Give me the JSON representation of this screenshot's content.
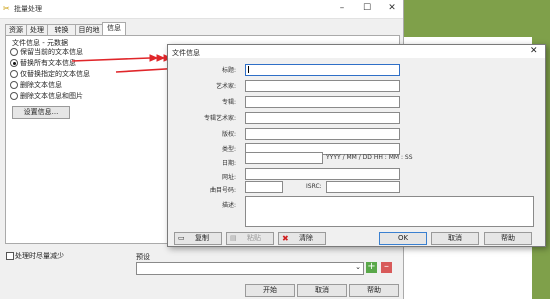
{
  "main_window": {
    "title": "批量处理",
    "tabs": [
      {
        "label": "资源",
        "active": false
      },
      {
        "label": "处理",
        "active": false
      },
      {
        "label": "转换",
        "active": false
      },
      {
        "label": "目的地",
        "active": false
      },
      {
        "label": "信息",
        "active": true
      }
    ],
    "group_title": "文件信息 - 元数据",
    "radio_options": [
      {
        "label": "保留当前的文本信息",
        "selected": false
      },
      {
        "label": "替换所有文本信息",
        "selected": true
      },
      {
        "label": "仅替换指定的文本信息",
        "selected": false
      },
      {
        "label": "删除文本信息",
        "selected": false
      },
      {
        "label": "删除文本信息和图片",
        "selected": false
      }
    ],
    "settings_button": "设置信息...",
    "reduce_checkbox": "处理时尽量减少",
    "preset_label": "预设",
    "preset_value": "",
    "buttons": {
      "start": "开始",
      "cancel": "取消",
      "help": "帮助"
    },
    "plus_icon": "plus-icon",
    "minus_icon": "minus-icon"
  },
  "dialog": {
    "title": "文件信息",
    "close": "✕",
    "fields": {
      "title": {
        "label": "标题:",
        "value": ""
      },
      "artist": {
        "label": "艺术家:",
        "value": ""
      },
      "album": {
        "label": "专辑:",
        "value": ""
      },
      "album_artist": {
        "label": "专辑艺术家:",
        "value": ""
      },
      "copyright": {
        "label": "版权:",
        "value": ""
      },
      "genre": {
        "label": "类型:",
        "value": ""
      },
      "date": {
        "label": "日期:",
        "value": "",
        "hint": "YYYY / MM / DD HH : MM : SS"
      },
      "url": {
        "label": "网址:",
        "value": ""
      },
      "track": {
        "label": "曲目号码:",
        "value": ""
      },
      "isrc": {
        "label": "ISRC:",
        "value": ""
      },
      "description": {
        "label": "描述:",
        "value": ""
      }
    },
    "buttons": {
      "copy": "复制",
      "paste": "粘贴",
      "clear": "清除",
      "ok": "OK",
      "cancel": "取消",
      "help": "帮助"
    }
  },
  "colors": {
    "arrow": "#e0262a",
    "desktop_green": "#7fa04a",
    "focus_blue": "#2f6fc7"
  }
}
